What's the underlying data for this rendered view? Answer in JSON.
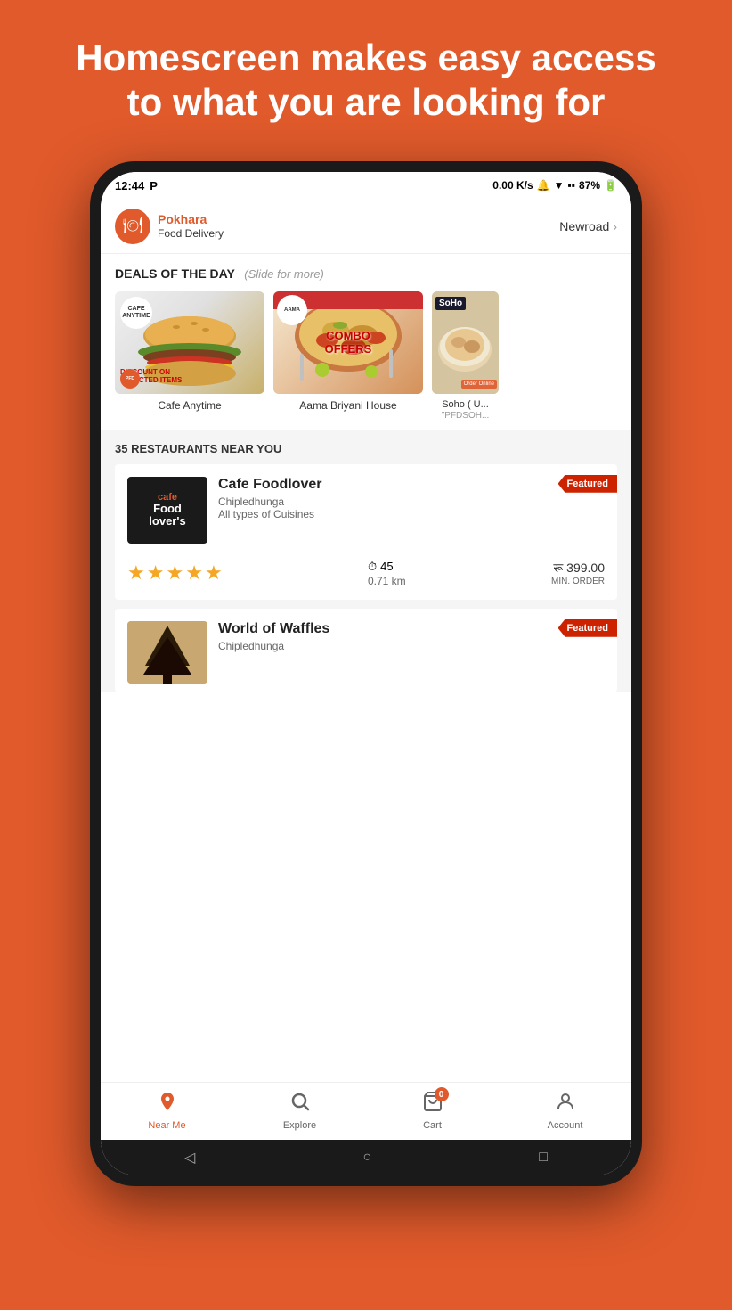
{
  "page": {
    "heading": "Homescreen makes easy access to what you are looking for",
    "bg_color": "#E05A2B"
  },
  "status_bar": {
    "time": "12:44",
    "notification_icon": "P",
    "speed": "0.00 K/s",
    "battery": "87%"
  },
  "app_header": {
    "logo_name": "Pokhara",
    "logo_sub": "Food Delivery",
    "location": "Newroad",
    "location_chevron": "›"
  },
  "deals": {
    "title": "DEALS OF THE DAY",
    "subtitle": "(Slide for more)",
    "items": [
      {
        "id": "cafe-anytime",
        "name": "Cafe Anytime",
        "badge": "CAFE ANYTIME",
        "discount_line1": "DISCOUNT ON",
        "discount_line2": "SELECTED ITEMS"
      },
      {
        "id": "aama-briyani",
        "name": "Aama Briyani House",
        "badge": "COMBO OFFERS"
      },
      {
        "id": "soho",
        "name": "Soho ( U...",
        "code": "\"PFDSOH..."
      }
    ]
  },
  "restaurants": {
    "count_label": "35 RESTAURANTS NEAR YOU",
    "items": [
      {
        "id": "cafe-foodlover",
        "name": "Cafe Foodlover",
        "area": "Chipledhunga",
        "cuisine": "All types of Cuisines",
        "stars": 5,
        "delivery_time": 45,
        "distance": "0.71 km",
        "min_order": "रू 399.00",
        "min_label": "MIN. ORDER",
        "featured": true
      },
      {
        "id": "world-of-waffles",
        "name": "World of Waffles",
        "area": "Chipledhunga",
        "cuisine": "",
        "stars": 0,
        "featured": true
      }
    ]
  },
  "bottom_nav": {
    "items": [
      {
        "id": "near-me",
        "label": "Near Me",
        "icon": "📍",
        "active": true
      },
      {
        "id": "explore",
        "label": "Explore",
        "icon": "🔍",
        "active": false
      },
      {
        "id": "cart",
        "label": "Cart",
        "icon": "🛒",
        "active": false,
        "badge": "0"
      },
      {
        "id": "account",
        "label": "Account",
        "icon": "👤",
        "active": false
      }
    ]
  },
  "android_nav": {
    "back": "◁",
    "home": "○",
    "recent": "□"
  }
}
